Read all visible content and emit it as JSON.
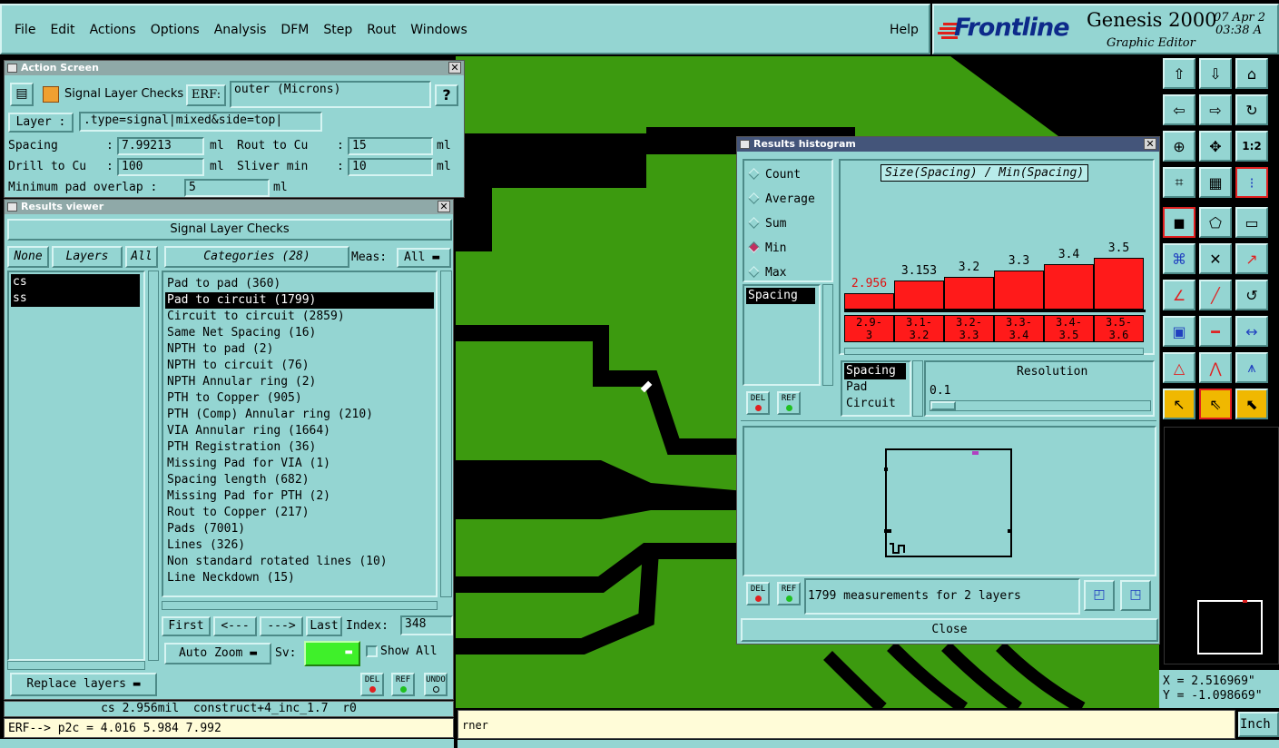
{
  "menu": {
    "items": [
      "File",
      "Edit",
      "Actions",
      "Options",
      "Analysis",
      "DFM",
      "Step",
      "Rout",
      "Windows"
    ],
    "help": "Help"
  },
  "brand": {
    "logo": "Frontline",
    "product": "Genesis 2000",
    "subtitle": "Graphic Editor",
    "date": "07 Apr 2",
    "time": "03:38 A"
  },
  "action_screen": {
    "title": "Action Screen",
    "header": "Signal Layer Checks",
    "erf_btn": "ERF:",
    "erf_value": "outer (Microns)",
    "help_btn": "?",
    "layer_btn": "Layer :",
    "layer_value": ".type=signal|mixed&side=top|",
    "spacing_label": "Spacing",
    "spacing_colon": ":",
    "spacing_value": "7.99213",
    "spacing_unit": "ml",
    "rout_label": "Rout to Cu",
    "rout_colon": ":",
    "rout_value": "15",
    "rout_unit": "ml",
    "drill_label": "Drill to Cu",
    "drill_colon": ":",
    "drill_value": "100",
    "drill_unit": "ml",
    "sliver_label": "Sliver min",
    "sliver_colon": ":",
    "sliver_value": "10",
    "sliver_unit": "ml",
    "minpad_label": "Minimum pad overlap :",
    "minpad_value": "5",
    "minpad_unit": "ml"
  },
  "results_viewer": {
    "title": "Results viewer",
    "header": "Signal Layer Checks",
    "none_btn": "None",
    "layers_btn": "Layers",
    "all_btn": "All",
    "layers": [
      "cs",
      "ss"
    ],
    "categories_btn": "Categories (28)",
    "meas_label": "Meas:",
    "meas_value": "All",
    "categories": [
      "Pad to pad (360)",
      "Pad to circuit (1799)",
      "Circuit to circuit (2859)",
      "Same Net Spacing (16)",
      "NPTH to pad (2)",
      "NPTH to circuit (76)",
      "NPTH Annular ring (2)",
      "PTH to Copper (905)",
      "PTH (Comp) Annular ring (210)",
      "VIA Annular ring (1664)",
      "PTH Registration (36)",
      "Missing Pad for VIA (1)",
      "Spacing length (682)",
      "Missing Pad for PTH (2)",
      "Rout to Copper (217)",
      "Pads (7001)",
      "Lines (326)",
      "Non standard rotated lines (10)",
      "Line Neckdown (15)"
    ],
    "selected_category": 1,
    "first_btn": "First",
    "prev_btn": "<---",
    "next_btn": "--->",
    "last_btn": "Last",
    "index_label": "Index:",
    "index_value": "348",
    "autozoom_btn": "Auto Zoom",
    "sv_label": "Sv:",
    "showall_label": "Show All",
    "replace_btn": "Replace layers",
    "del": "DEL",
    "ref": "REF",
    "undo": "UNDO",
    "status": "cs 2.956mil  construct+4_inc_1.7  r0"
  },
  "erf_line": "ERF--> p2c = 4.016 5.984 7.992",
  "histogram": {
    "title": "Results histogram",
    "modes": [
      "Count",
      "Average",
      "Sum",
      "Min",
      "Max"
    ],
    "active_mode": "Min",
    "chart_title": "Size(Spacing) / Min(Spacing)",
    "measure_list": [
      "Spacing"
    ],
    "res_list": [
      "Spacing",
      "Pad",
      "Circuit"
    ],
    "res_label": "Resolution",
    "res_value": "0.1",
    "del": "DEL",
    "ref": "REF",
    "summary": "1799 measurements for 2 layers",
    "close_btn": "Close"
  },
  "chart_data": {
    "type": "bar",
    "categories": [
      "2.9-3",
      "3.1-3.2",
      "3.2-3.3",
      "3.3-3.4",
      "3.4-3.5",
      "3.5-3.6"
    ],
    "bin_labels": [
      [
        "2.9-",
        "3"
      ],
      [
        "3.1-",
        "3.2"
      ],
      [
        "3.2-",
        "3.3"
      ],
      [
        "3.3-",
        "3.4"
      ],
      [
        "3.4-",
        "3.5"
      ],
      [
        "3.5-",
        "3.6"
      ]
    ],
    "values": [
      2.956,
      3.153,
      3.2,
      3.3,
      3.4,
      3.5
    ],
    "value_labels": [
      "2.956",
      "3.153",
      "3.2",
      "3.3",
      "3.4",
      "3.5"
    ],
    "title": "Size(Spacing) / Min(Spacing)",
    "ylim": [
      2.7,
      3.6
    ],
    "bar_color": "#ff1a1a"
  },
  "coords": {
    "x": "X = 2.516969\"",
    "y": "Y = -1.098669\""
  },
  "bottom": {
    "prompt": "rner",
    "units": "Inch"
  },
  "colors": {
    "panel": "#94d5d2",
    "copper": "#3c9a0f",
    "background": "#000000",
    "accent_red": "#ff1a1a"
  }
}
